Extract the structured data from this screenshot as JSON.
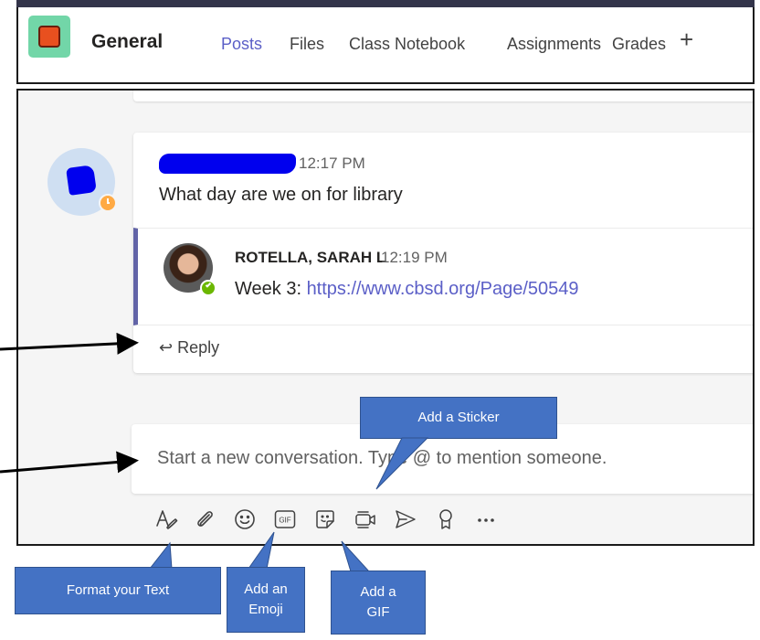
{
  "header": {
    "channel_name": "General",
    "tabs": [
      {
        "label": "Posts",
        "active": true
      },
      {
        "label": "Files",
        "active": false
      },
      {
        "label": "Class Notebook",
        "active": false
      },
      {
        "label": "Assignments",
        "active": false
      },
      {
        "label": "Grades",
        "active": false
      }
    ],
    "add_tab_label": "+"
  },
  "post": {
    "time": "12:17 PM",
    "body": "What day are we on for library",
    "reply": {
      "author": "ROTELLA, SARAH L",
      "time": "12:19 PM",
      "text_prefix": "Week 3: ",
      "link": "https://www.cbsd.org/Page/50549"
    },
    "reply_button_label": "Reply"
  },
  "compose": {
    "placeholder": "Start a new conversation. Type @ to mention someone."
  },
  "toolbar": {
    "icons": [
      "format-icon",
      "attach-icon",
      "emoji-icon",
      "gif-icon",
      "sticker-icon",
      "meet-now-icon",
      "send-icon",
      "praise-icon",
      "more-icon"
    ],
    "gif_label": "GIF"
  },
  "callouts": {
    "sticker": "Add a Sticker",
    "format": "Format your Text",
    "emoji_line1": "Add an",
    "emoji_line2": "Emoji",
    "gif_line1": "Add a",
    "gif_line2": "GIF"
  },
  "colors": {
    "accent": "#5b5fc7",
    "callout": "#4472c4",
    "away": "#ffaa44",
    "online": "#6bb700",
    "redaction": "#0000ee"
  }
}
